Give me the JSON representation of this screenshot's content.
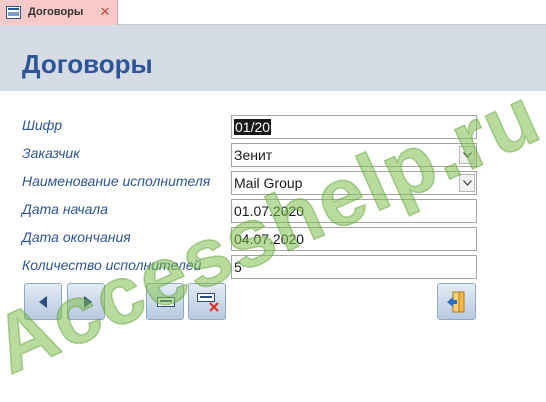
{
  "tab": {
    "label": "Договоры",
    "icon": "form-icon",
    "close_icon": "close-icon"
  },
  "header": {
    "title": "Договоры"
  },
  "fields": [
    {
      "label": "Шифр",
      "value": "01/20"
    },
    {
      "label": "Заказчик",
      "value": "Зенит"
    },
    {
      "label": "Наименование исполнителя",
      "value": "Mail Group"
    },
    {
      "label": "Дата начала",
      "value": "01.07.2020"
    },
    {
      "label": "Дата окончания",
      "value": "04.07.2020"
    },
    {
      "label": "Количество исполнителей",
      "value": "5"
    }
  ],
  "buttons": {
    "previous": {
      "icon": "arrow-left-icon"
    },
    "next": {
      "icon": "arrow-right-icon"
    },
    "new_record": {
      "icon": "new-record-icon"
    },
    "delete_record": {
      "icon": "delete-record-icon"
    },
    "close_form": {
      "icon": "exit-door-icon"
    }
  },
  "watermark": {
    "text": "Accesshelp.ru"
  },
  "colors": {
    "tab_bg": "#f8c9c9",
    "header_bg": "#d6dce5",
    "title": "#2e5597",
    "label": "#2e5597",
    "watermark": "#7fbf4f"
  }
}
